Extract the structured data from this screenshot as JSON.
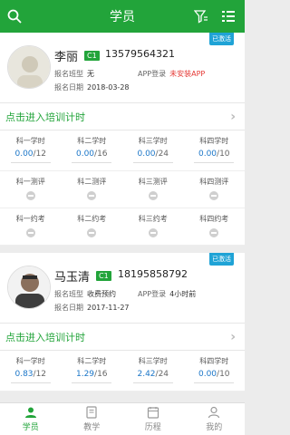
{
  "header": {
    "title": "学员"
  },
  "students": [
    {
      "name": "李丽",
      "level": "C1",
      "phone": "13579564321",
      "status": "已激活",
      "class_label": "报名班型",
      "class_value": "无",
      "date_label": "报名日期",
      "date_value": "2018-03-28",
      "app_label": "APP登录",
      "app_value": "未安装APP",
      "app_color": "#e53935",
      "enter": "点击进入培训计时",
      "hours": [
        {
          "label": "科一学时",
          "done": "0.00",
          "total": "/12"
        },
        {
          "label": "科二学时",
          "done": "0.00",
          "total": "/16"
        },
        {
          "label": "科三学时",
          "done": "0.00",
          "total": "/24"
        },
        {
          "label": "科四学时",
          "done": "0.00",
          "total": "/10"
        }
      ],
      "evals": [
        "科一测评",
        "科二测评",
        "科三测评",
        "科四测评"
      ],
      "exams": [
        "科一约考",
        "科二约考",
        "科三约考",
        "科四约考"
      ]
    },
    {
      "name": "马玉清",
      "level": "C1",
      "phone": "18195858792",
      "status": "已激活",
      "class_label": "报名班型",
      "class_value": "收费预约",
      "date_label": "报名日期",
      "date_value": "2017-11-27",
      "app_label": "APP登录",
      "app_value": "4小时前",
      "app_color": "#333333",
      "enter": "点击进入培训计时",
      "hours": [
        {
          "label": "科一学时",
          "done": "0.83",
          "total": "/12"
        },
        {
          "label": "科二学时",
          "done": "1.29",
          "total": "/16"
        },
        {
          "label": "科三学时",
          "done": "2.42",
          "total": "/24"
        },
        {
          "label": "科四学时",
          "done": "0.00",
          "total": "/10"
        }
      ]
    }
  ],
  "tabs": [
    {
      "label": "学员",
      "icon": "student-icon"
    },
    {
      "label": "教学",
      "icon": "book-icon"
    },
    {
      "label": "历程",
      "icon": "history-icon"
    },
    {
      "label": "我的",
      "icon": "profile-icon"
    }
  ]
}
